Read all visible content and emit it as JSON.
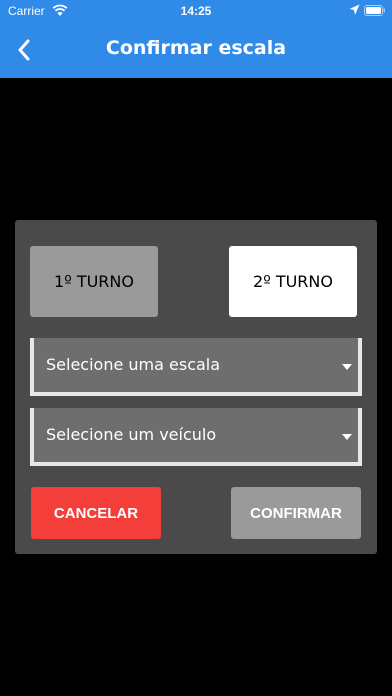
{
  "status_bar": {
    "carrier": "Carrier",
    "time": "14:25",
    "icons": [
      "wifi-icon",
      "location-icon",
      "battery-icon"
    ]
  },
  "header": {
    "title": "Confirmar escala",
    "back_icon": "chevron-left-icon",
    "background_color": "#2f8ae8"
  },
  "dialog": {
    "turns": [
      {
        "label": "1º TURNO",
        "selected": false
      },
      {
        "label": "2º TURNO",
        "selected": true
      }
    ],
    "escala_select": {
      "placeholder": "Selecione uma escala"
    },
    "veiculo_select": {
      "placeholder": "Selecione um veículo"
    },
    "cancel_label": "CANCELAR",
    "confirm_label": "CONFIRMAR"
  },
  "colors": {
    "accent": "#2f8ae8",
    "dialog_bg": "#4a4a4a",
    "cancel": "#f33e3a",
    "confirm_disabled": "#9a9a9a"
  }
}
